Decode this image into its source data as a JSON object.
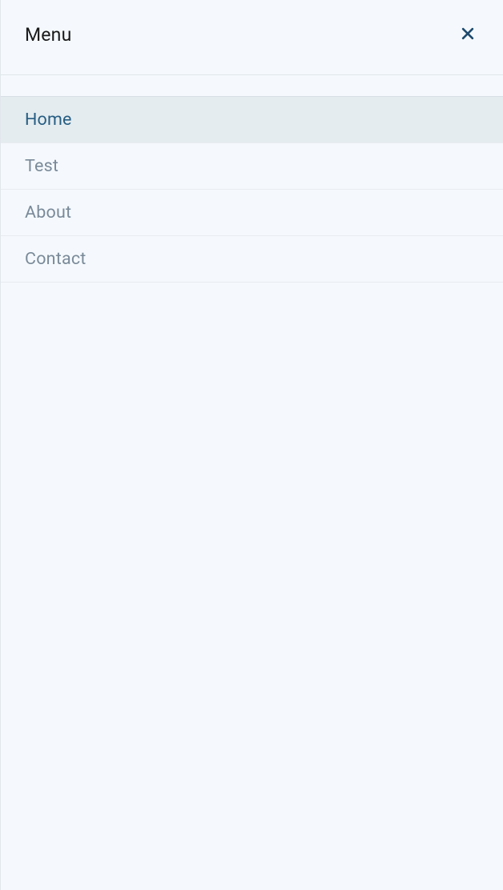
{
  "drawer": {
    "title": "Menu",
    "items": [
      {
        "label": "Home",
        "active": true
      },
      {
        "label": "Test",
        "active": false
      },
      {
        "label": "About",
        "active": false
      },
      {
        "label": "Contact",
        "active": false
      }
    ]
  }
}
